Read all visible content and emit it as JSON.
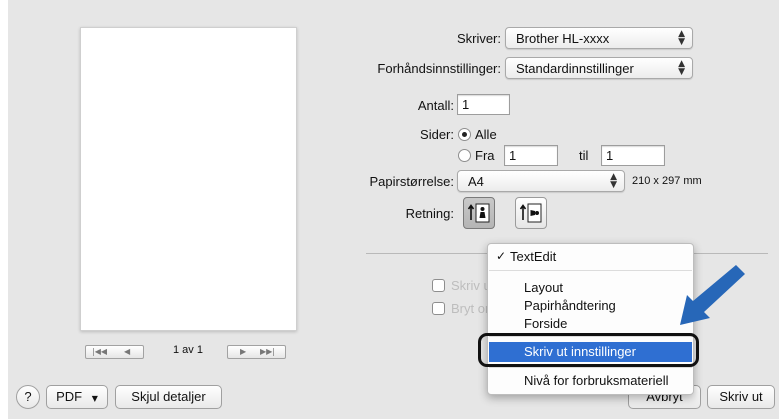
{
  "printer": {
    "label": "Skriver:",
    "value": "Brother HL-xxxx"
  },
  "presets": {
    "label": "Forhåndsinnstillinger:",
    "value": "Standardinnstillinger"
  },
  "copies": {
    "label": "Antall:",
    "value": "1"
  },
  "pages": {
    "label": "Sider:",
    "all_label": "Alle",
    "from_label": "Fra",
    "from_value": "1",
    "to_label": "til",
    "to_value": "1",
    "selected": "all"
  },
  "paper": {
    "label": "Papirstørrelse:",
    "value": "A4",
    "dimensions": "210 x 297 mm"
  },
  "orientation": {
    "label": "Retning:",
    "selected": "portrait"
  },
  "options": {
    "header_footer": "Skriv ut topptekst og bunntekst",
    "rewrap": "Bryt om innholdet for å passe til siden"
  },
  "preview": {
    "page_indicator": "1 av 1"
  },
  "menu": {
    "checked_item": "TextEdit",
    "items": [
      "Layout",
      "Papirhåndtering",
      "Forside",
      "Skriv ut innstillinger",
      "Nivå for forbruksmateriell"
    ],
    "highlighted_item": "Skriv ut innstillinger"
  },
  "footer": {
    "help": "?",
    "pdf": "PDF",
    "hide_details": "Skjul detaljer",
    "cancel": "Avbryt",
    "print": "Skriv ut"
  },
  "colors": {
    "highlight": "#2f6fd2",
    "arrow": "#2767b8",
    "callout": "#111111"
  }
}
